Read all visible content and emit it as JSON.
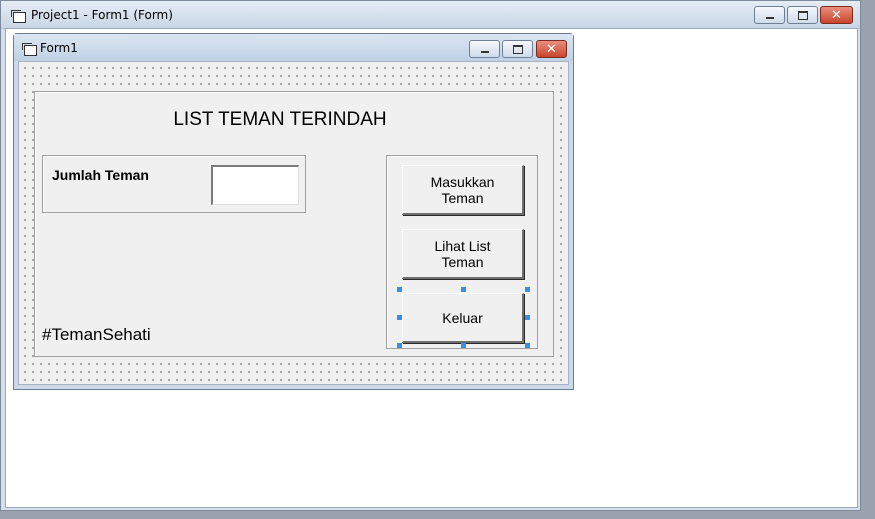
{
  "outer_window": {
    "title": "Project1 - Form1 (Form)",
    "icon": "form-icon",
    "caption_buttons": {
      "minimize": "minimize-icon",
      "maximize": "maximize-icon",
      "close": "✕"
    }
  },
  "form_window": {
    "title": "Form1",
    "icon": "form-icon",
    "caption_buttons": {
      "minimize": "minimize-icon",
      "maximize": "maximize-icon",
      "close": "✕"
    }
  },
  "form": {
    "heading": "LIST TEMAN TERINDAH",
    "count_label": "Jumlah Teman",
    "count_input_value": "",
    "hashtag": "#TemanSehati",
    "buttons": {
      "add": "Masukkan\nTeman",
      "view": "Lihat List\nTeman",
      "exit": "Keluar"
    }
  },
  "colors": {
    "selection_handle": "#3b8fe0",
    "close_button": "#c8452c",
    "form_background": "#f0f0f0"
  }
}
